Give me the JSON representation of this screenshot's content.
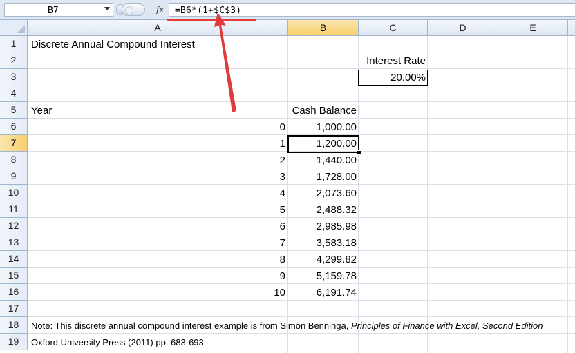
{
  "formula_bar": {
    "name_box": "B7",
    "fx_label": "fx",
    "formula": "=B6*(1+$C$3)"
  },
  "columns": [
    "A",
    "B",
    "C",
    "D",
    "E"
  ],
  "selected_column": "B",
  "rows": [
    "1",
    "2",
    "3",
    "4",
    "5",
    "6",
    "7",
    "8",
    "9",
    "10",
    "11",
    "12",
    "13",
    "14",
    "15",
    "16",
    "17",
    "18",
    "19"
  ],
  "selected_row": "7",
  "sheet": {
    "title": "Discrete Annual Compound Interest",
    "rate_label": "Interest Rate",
    "rate_value": "20.00%",
    "year_header": "Year",
    "balance_header": "Cash Balance",
    "table": [
      {
        "year": "0",
        "balance": "1,000.00"
      },
      {
        "year": "1",
        "balance": "1,200.00"
      },
      {
        "year": "2",
        "balance": "1,440.00"
      },
      {
        "year": "3",
        "balance": "1,728.00"
      },
      {
        "year": "4",
        "balance": "2,073.60"
      },
      {
        "year": "5",
        "balance": "2,488.32"
      },
      {
        "year": "6",
        "balance": "2,985.98"
      },
      {
        "year": "7",
        "balance": "3,583.18"
      },
      {
        "year": "8",
        "balance": "4,299.82"
      },
      {
        "year": "9",
        "balance": "5,159.78"
      },
      {
        "year": "10",
        "balance": "6,191.74"
      }
    ],
    "note_prefix": "Note: This discrete annual compound interest example is from Simon Benninga, ",
    "note_book": "Principles of Finance with Excel, Second Edition",
    "note_line2": "Oxford University Press (2011) pp. 683-693"
  },
  "annotation_color": "#e23a3a"
}
